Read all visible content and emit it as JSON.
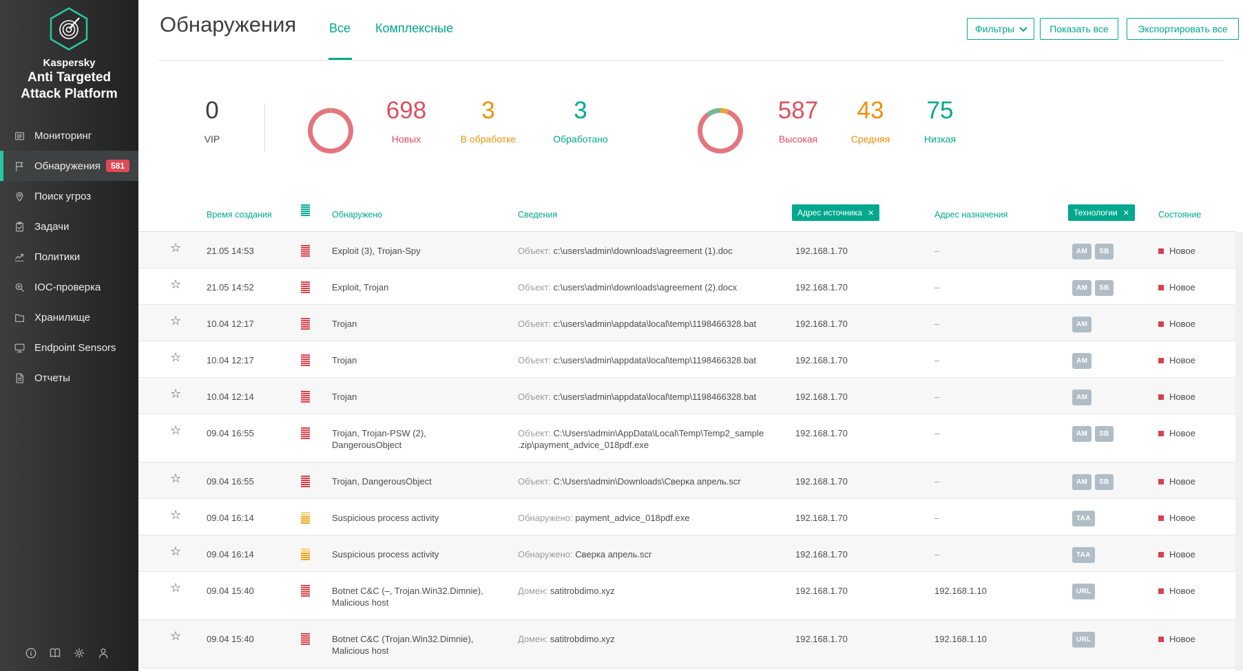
{
  "app": {
    "brand": "Kaspersky",
    "product": "Anti Targeted Attack Platform"
  },
  "sidebar": {
    "items": [
      {
        "label": "Мониторинг",
        "icon": "monitoring"
      },
      {
        "label": "Обнаружения",
        "icon": "detections",
        "badge": "581",
        "active": true
      },
      {
        "label": "Поиск угроз",
        "icon": "threat-search"
      },
      {
        "label": "Задачи",
        "icon": "tasks"
      },
      {
        "label": "Политики",
        "icon": "policies"
      },
      {
        "label": "IOC-проверка",
        "icon": "ioc"
      },
      {
        "label": "Хранилище",
        "icon": "storage"
      },
      {
        "label": "Endpoint Sensors",
        "icon": "endpoint"
      },
      {
        "label": "Отчеты",
        "icon": "reports"
      }
    ],
    "footer_icons": [
      "info",
      "book",
      "gear",
      "user"
    ]
  },
  "header": {
    "title": "Обнаружения",
    "tabs": [
      {
        "label": "Все",
        "active": true
      },
      {
        "label": "Комплексные",
        "active": false
      }
    ],
    "buttons": [
      {
        "label": "Фильтры",
        "has_chevron": true
      },
      {
        "label": "Показать все"
      },
      {
        "label": "Экспортировать все"
      }
    ]
  },
  "stats": {
    "vip": {
      "value": "0",
      "label": "VIP"
    },
    "new": {
      "value": "698",
      "label": "Новых"
    },
    "in_progress": {
      "value": "3",
      "label": "В обработке"
    },
    "processed": {
      "value": "3",
      "label": "Обработано"
    },
    "high": {
      "value": "587",
      "label": "Высокая"
    },
    "medium": {
      "value": "43",
      "label": "Средняя"
    },
    "low": {
      "value": "75",
      "label": "Низкая"
    }
  },
  "chart_data": [
    {
      "type": "pie",
      "variant": "donut",
      "name": "detections-by-state",
      "segments": [
        {
          "label": "В обработке",
          "value": 3,
          "color": "#f0a23c"
        },
        {
          "label": "Новых",
          "value": 698,
          "color": "#e4757e"
        },
        {
          "label": "Обработано",
          "value": 3,
          "color": "#72b894"
        }
      ],
      "total": 704,
      "legend_position": "right-inline"
    },
    {
      "type": "pie",
      "variant": "donut",
      "name": "detections-by-severity",
      "segments": [
        {
          "label": "Средняя",
          "value": 43,
          "color": "#f0a23c"
        },
        {
          "label": "Высокая",
          "value": 587,
          "color": "#e4757e"
        },
        {
          "label": "Низкая",
          "value": 75,
          "color": "#72b894"
        }
      ],
      "total": 705,
      "legend_position": "right-inline"
    }
  ],
  "table": {
    "columns": {
      "time": "Время создания",
      "detected": "Обнаружено",
      "details": "Сведения",
      "source": "Адрес источника",
      "destination": "Адрес назначения",
      "technologies": "Технологии",
      "state": "Состояние"
    },
    "active_filters": [
      "Адрес источника",
      "Технологии"
    ],
    "remove_glyph": "✕",
    "rows": [
      {
        "time": "21.05 14:53",
        "importance": "high",
        "detected": "Exploit (3), Trojan-Spy",
        "details_label": "Объект:",
        "details_value": "c:\\users\\admin\\downloads\\agreement (1).doc",
        "source": "192.168.1.70",
        "destination": "–",
        "technologies": [
          "AM",
          "SB"
        ],
        "state": "Новое",
        "tall": false
      },
      {
        "time": "21.05 14:52",
        "importance": "high",
        "detected": "Exploit, Trojan",
        "details_label": "Объект:",
        "details_value": "c:\\users\\admin\\downloads\\agreement (2).docx",
        "source": "192.168.1.70",
        "destination": "–",
        "technologies": [
          "AM",
          "SB"
        ],
        "state": "Новое",
        "tall": false
      },
      {
        "time": "10.04 12:17",
        "importance": "high",
        "detected": "Trojan",
        "details_label": "Объект:",
        "details_value": "c:\\users\\admin\\appdata\\local\\temp\\1198466328.bat",
        "source": "192.168.1.70",
        "destination": "–",
        "technologies": [
          "AM"
        ],
        "state": "Новое",
        "tall": false
      },
      {
        "time": "10.04 12:17",
        "importance": "high",
        "detected": "Trojan",
        "details_label": "Объект:",
        "details_value": "c:\\users\\admin\\appdata\\local\\temp\\1198466328.bat",
        "source": "192.168.1.70",
        "destination": "–",
        "technologies": [
          "AM"
        ],
        "state": "Новое",
        "tall": false
      },
      {
        "time": "10.04 12:14",
        "importance": "high",
        "detected": "Trojan",
        "details_label": "Объект:",
        "details_value": "c:\\users\\admin\\appdata\\local\\temp\\1198466328.bat",
        "source": "192.168.1.70",
        "destination": "–",
        "technologies": [
          "AM"
        ],
        "state": "Новое",
        "tall": false
      },
      {
        "time": "09.04 16:55",
        "importance": "high",
        "detected": "Trojan, Trojan-PSW (2),\nDangerousObject",
        "details_label": "Объект:",
        "details_value": "C:\\Users\\admin\\AppData\\Local\\Temp\\Temp2_sample\n.zip\\payment_advice_018pdf.exe",
        "source": "192.168.1.70",
        "destination": "–",
        "technologies": [
          "AM",
          "SB"
        ],
        "state": "Новое",
        "tall": true
      },
      {
        "time": "09.04 16:55",
        "importance": "high",
        "detected": "Trojan, DangerousObject",
        "details_label": "Объект:",
        "details_value": "C:\\Users\\admin\\Downloads\\Сверка апрель.scr",
        "source": "192.168.1.70",
        "destination": "–",
        "technologies": [
          "AM",
          "SB"
        ],
        "state": "Новое",
        "tall": false
      },
      {
        "time": "09.04 16:14",
        "importance": "medium",
        "detected": "Suspicious process activity",
        "details_label": "Обнаружено:",
        "details_value": "payment_advice_018pdf.exe",
        "source": "192.168.1.70",
        "destination": "–",
        "technologies": [
          "TAA"
        ],
        "state": "Новое",
        "tall": false
      },
      {
        "time": "09.04 16:14",
        "importance": "medium",
        "detected": "Suspicious process activity",
        "details_label": "Обнаружено:",
        "details_value": "Сверка апрель.scr",
        "source": "192.168.1.70",
        "destination": "–",
        "technologies": [
          "TAA"
        ],
        "state": "Новое",
        "tall": false
      },
      {
        "time": "09.04 15:40",
        "importance": "high",
        "detected": "Botnet C&C (–, Trojan.Win32.Dimnie),\nMalicious host",
        "details_label": "Домен:",
        "details_value": "satitrobdimo.xyz",
        "source": "192.168.1.70",
        "destination": "192.168.1.10",
        "technologies": [
          "URL"
        ],
        "state": "Новое",
        "tall": true
      },
      {
        "time": "09.04 15:40",
        "importance": "high",
        "detected": "Botnet C&C (Trojan.Win32.Dimnie),\nMalicious host",
        "details_label": "Домен:",
        "details_value": "satitrobdimo.xyz",
        "source": "192.168.1.70",
        "destination": "192.168.1.10",
        "technologies": [
          "URL"
        ],
        "state": "Новое",
        "tall": true
      }
    ]
  },
  "colors": {
    "accent_teal": "#00a88e",
    "sidebar_active_teal": "#2bc6a3",
    "badge_red": "#e04a54",
    "stat_red": "#de4e5e",
    "stat_orange": "#ee9008",
    "stat_teal": "#00a88e",
    "donut_red": "#e4757e",
    "donut_orange": "#f0a23c",
    "donut_teal": "#72b894",
    "importance_high_red": "#d6414d",
    "technology_chip_gray": "#b0bdc6",
    "state_new_red": "#d6414d"
  }
}
